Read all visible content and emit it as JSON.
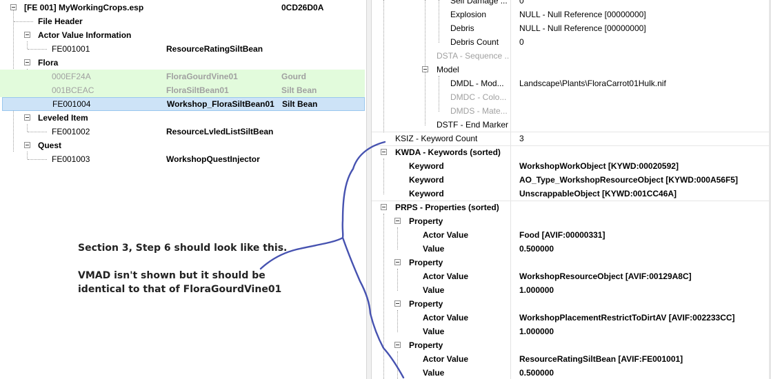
{
  "left_tree": {
    "plugin_label": "[FE 001] MyWorkingCrops.esp",
    "plugin_crc": "0CD26D0A",
    "file_header": "File Header",
    "avi_group": "Actor Value Information",
    "avi_items": [
      {
        "form_id": "FE001001",
        "editor_id": "ResourceRatingSiltBean",
        "name": ""
      }
    ],
    "flora_group": "Flora",
    "flora_items": [
      {
        "form_id": "000EF24A",
        "editor_id": "FloraGourdVine01",
        "name": "Gourd"
      },
      {
        "form_id": "001BCEAC",
        "editor_id": "FloraSiltBean01",
        "name": "Silt Bean"
      },
      {
        "form_id": "FE001004",
        "editor_id": "Workshop_FloraSiltBean01",
        "name": "Silt Bean"
      }
    ],
    "leveled_group": "Leveled Item",
    "leveled_items": [
      {
        "form_id": "FE001002",
        "editor_id": "ResourceLvledListSiltBean",
        "name": ""
      }
    ],
    "quest_group": "Quest",
    "quest_items": [
      {
        "form_id": "FE001003",
        "editor_id": "WorkshopQuestInjector",
        "name": ""
      }
    ]
  },
  "record_view": {
    "rows": [
      {
        "label": "Self Damage ...",
        "value": "0"
      },
      {
        "label": "Explosion",
        "value": "NULL - Null Reference [00000000]"
      },
      {
        "label": "Debris",
        "value": "NULL - Null Reference [00000000]"
      },
      {
        "label": "Debris Count",
        "value": "0"
      },
      {
        "label": "DSTA - Sequence ...",
        "value": ""
      },
      {
        "label": "Model",
        "value": ""
      },
      {
        "label": "DMDL - Mod...",
        "value": "Landscape\\Plants\\FloraCarrot01Hulk.nif"
      },
      {
        "label": "DMDC - Colo...",
        "value": ""
      },
      {
        "label": "DMDS - Mate...",
        "value": ""
      },
      {
        "label": "DSTF - End Marker",
        "value": ""
      },
      {
        "label": "KSIZ - Keyword Count",
        "value": "3"
      },
      {
        "label": "KWDA - Keywords (sorted)",
        "value": ""
      },
      {
        "label": "Keyword",
        "value": "WorkshopWorkObject [KYWD:00020592]"
      },
      {
        "label": "Keyword",
        "value": "AO_Type_WorkshopResourceObject [KYWD:000A56F5]"
      },
      {
        "label": "Keyword",
        "value": "UnscrappableObject [KYWD:001CC46A]"
      },
      {
        "label": "PRPS - Properties (sorted)",
        "value": ""
      },
      {
        "label": "Property",
        "value": ""
      },
      {
        "label": "Actor Value",
        "value": "Food [AVIF:00000331]"
      },
      {
        "label": "Value",
        "value": "0.500000"
      },
      {
        "label": "Property",
        "value": ""
      },
      {
        "label": "Actor Value",
        "value": "WorkshopResourceObject [AVIF:00129A8C]"
      },
      {
        "label": "Value",
        "value": "1.000000"
      },
      {
        "label": "Property",
        "value": ""
      },
      {
        "label": "Actor Value",
        "value": "WorkshopPlacementRestrictToDirtAV [AVIF:002233CC]"
      },
      {
        "label": "Value",
        "value": "1.000000"
      },
      {
        "label": "Property",
        "value": ""
      },
      {
        "label": "Actor Value",
        "value": "ResourceRatingSiltBean [AVIF:FE001001]"
      },
      {
        "label": "Value",
        "value": "0.500000"
      }
    ]
  },
  "annotation": {
    "line1": "Section 3, Step 6 should look like this.",
    "line2": "VMAD isn't shown but it should be",
    "line3": "identical to that of FloraGourdVine01"
  },
  "colors": {
    "selection": "#cde3f7",
    "override_green": "#e2fbdc",
    "ink": "#4652b0"
  }
}
